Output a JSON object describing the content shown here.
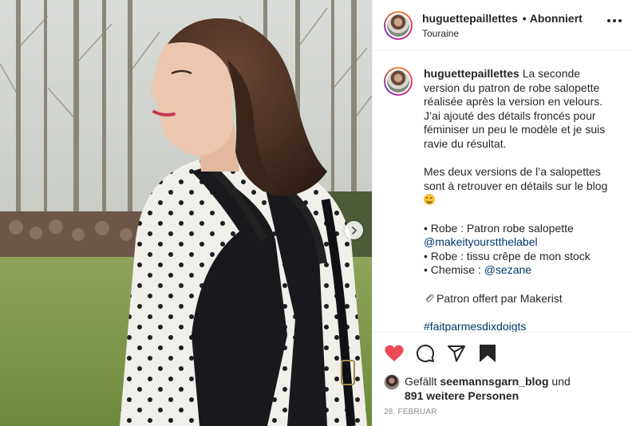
{
  "post": {
    "username": "huguettepaillettes",
    "separator": "•",
    "follow_state": "Abonniert",
    "location": "Touraine"
  },
  "caption": {
    "username": "huguettepaillettes",
    "line1": "La seconde version du patron de robe salopette réalisée après la version en velours. J’ai ajouté des détails froncés pour féminiser un peu le modèle et je suis ravie du résultat.",
    "line2": "Mes deux versions de l’a salopettes sont à retrouver en détails sur le blog",
    "emoji_icon": "hugging-face-emoji",
    "bullet1": "• Robe : Patron robe salopette",
    "mention1": "@makeityourstthelabel",
    "bullet2": "• Robe : tissu crêpe de mon stock",
    "bullet3": "• Chemise : ",
    "mention2": "@sezane",
    "gift_text": "Patron offert par Makerist",
    "hashtag": "#faitparmesdixdoigts"
  },
  "actions": {
    "liked": true,
    "like_color": "#ed4956",
    "liked_by_prefix": "Gefällt ",
    "liked_by_user": "seemannsgarn_blog",
    "liked_by_suffix": " und",
    "others_count": "891 weitere Personen",
    "date": "28. FEBRUAR"
  },
  "icons": [
    "heart-icon",
    "comment-icon",
    "share-icon",
    "bookmark-icon",
    "more-icon",
    "chevron-right-icon",
    "paperclip-icon"
  ],
  "colors": {
    "text": "#262626",
    "mention": "#00376b",
    "muted": "#8e8e8e",
    "border": "#efefef"
  }
}
